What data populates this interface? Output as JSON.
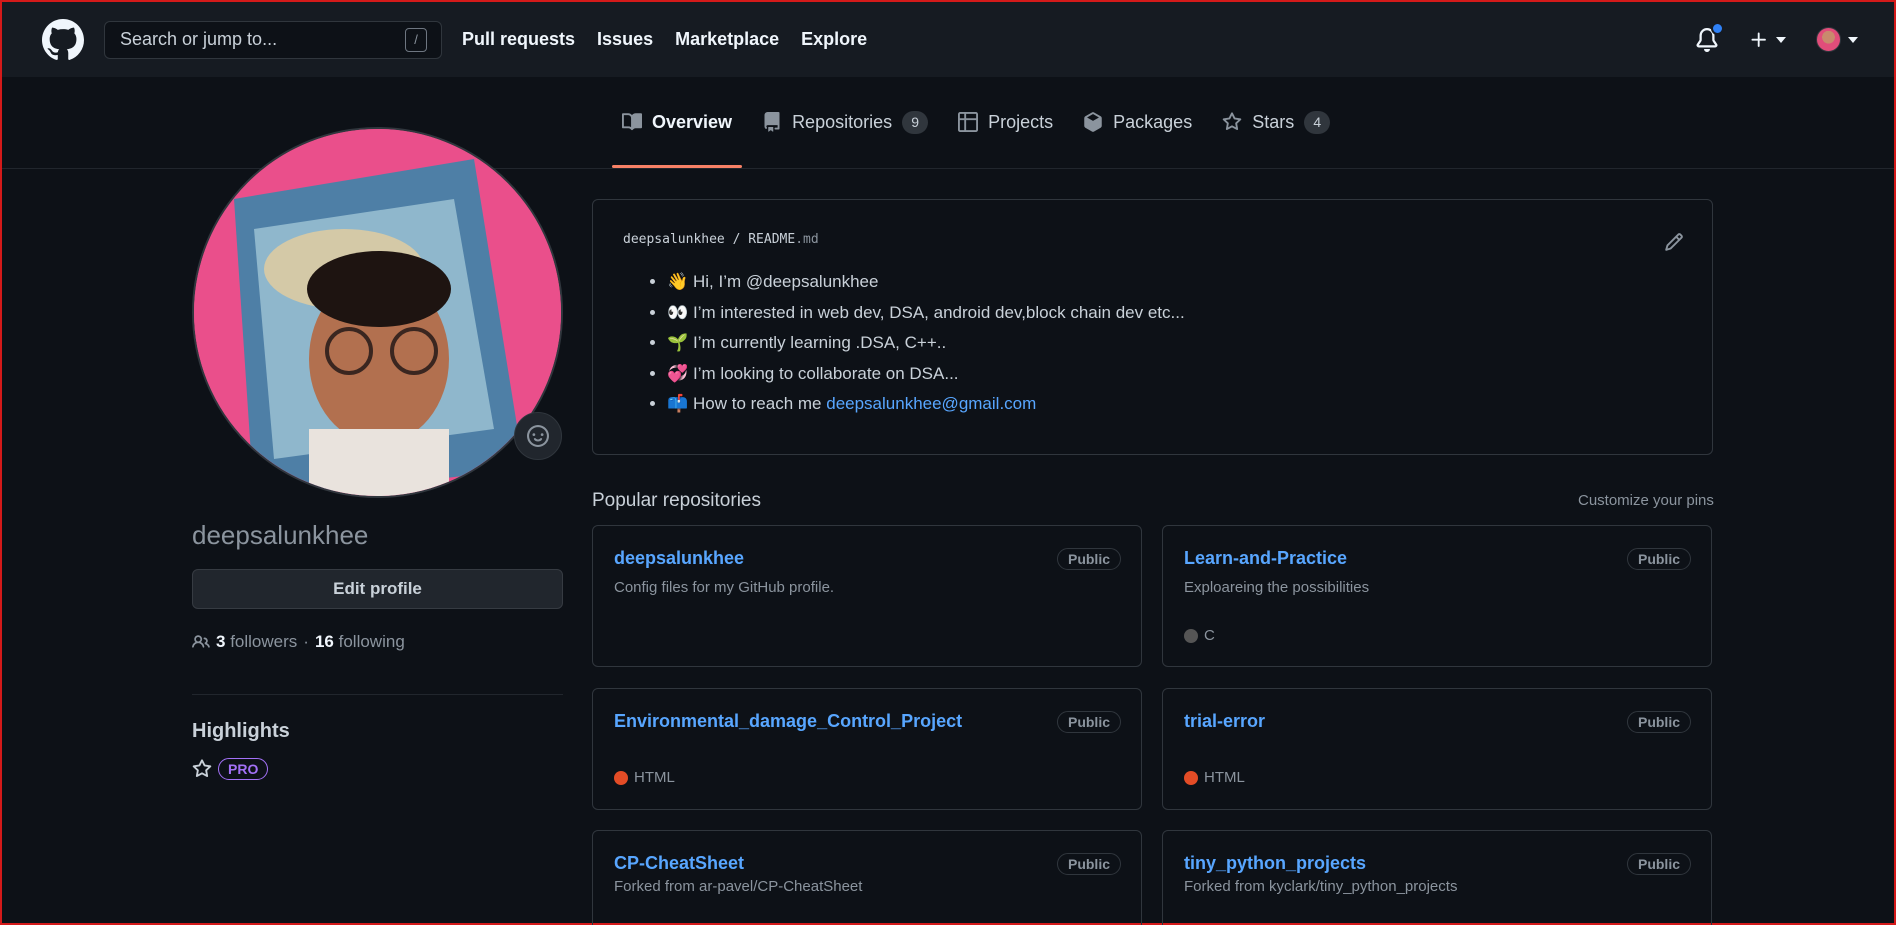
{
  "header": {
    "search_placeholder": "Search or jump to...",
    "search_shortcut": "/",
    "nav": [
      "Pull requests",
      "Issues",
      "Marketplace",
      "Explore"
    ]
  },
  "tabs": [
    {
      "label": "Overview",
      "icon": "book-icon",
      "count": null,
      "active": true
    },
    {
      "label": "Repositories",
      "icon": "repo-icon",
      "count": "9",
      "active": false
    },
    {
      "label": "Projects",
      "icon": "project-icon",
      "count": null,
      "active": false
    },
    {
      "label": "Packages",
      "icon": "package-icon",
      "count": null,
      "active": false
    },
    {
      "label": "Stars",
      "icon": "star-icon",
      "count": "4",
      "active": false
    }
  ],
  "profile": {
    "username": "deepsalunkhee",
    "edit_label": "Edit profile",
    "followers_count": "3",
    "followers_label": "followers",
    "separator": "·",
    "following_count": "16",
    "following_label": "following",
    "highlights_title": "Highlights",
    "pro_label": "PRO"
  },
  "readme": {
    "owner": "deepsalunkhee",
    "sep": "/",
    "file_base": "README",
    "file_ext": ".md",
    "items": [
      {
        "emoji": "👋",
        "text": "Hi, I’m @deepsalunkhee",
        "link": null
      },
      {
        "emoji": "👀",
        "text": "I’m interested in web dev, DSA, android dev,block chain dev etc...",
        "link": null
      },
      {
        "emoji": "🌱",
        "text": "I’m currently learning .DSA, C++..",
        "link": null
      },
      {
        "emoji": "💞",
        "text": "I’m looking to collaborate on DSA...",
        "link": null
      },
      {
        "emoji": "📫",
        "text": "How to reach me ",
        "link": "deepsalunkhee@gmail.com"
      }
    ]
  },
  "popular": {
    "title": "Popular repositories",
    "customize": "Customize your pins",
    "repos": [
      {
        "name": "deepsalunkhee",
        "visibility": "Public",
        "desc": "Config files for my GitHub profile.",
        "lang": null,
        "lang_color": null
      },
      {
        "name": "Learn-and-Practice",
        "visibility": "Public",
        "desc": "Exploareing the possibilities",
        "lang": "C",
        "lang_color": "#555555"
      },
      {
        "name": "Environmental_damage_Control_Project",
        "visibility": "Public",
        "desc": "",
        "lang": "HTML",
        "lang_color": "#e34c26"
      },
      {
        "name": "trial-error",
        "visibility": "Public",
        "desc": "",
        "lang": "HTML",
        "lang_color": "#e34c26"
      },
      {
        "name": "CP-CheatSheet",
        "visibility": "Public",
        "desc": "Forked from ar-pavel/CP-CheatSheet",
        "lang": null,
        "lang_color": null
      },
      {
        "name": "tiny_python_projects",
        "visibility": "Public",
        "desc": "Forked from kyclark/tiny_python_projects",
        "lang": null,
        "lang_color": null
      }
    ]
  }
}
